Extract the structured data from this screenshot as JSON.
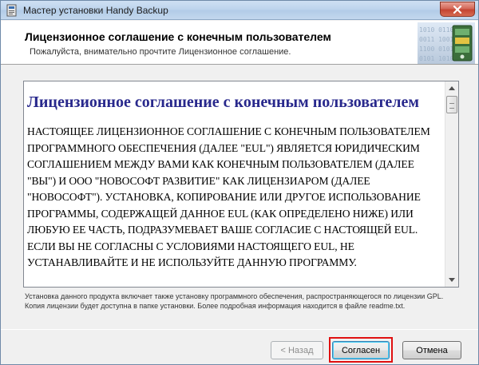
{
  "window": {
    "title": "Мастер установки Handy Backup"
  },
  "header": {
    "title": "Лицензионное соглашение с конечным пользователем",
    "subtitle": "Пожалуйста, внимательно прочтите Лицензионное соглашение."
  },
  "license": {
    "heading": "Лицензионное соглашение с конечным пользователем",
    "body": "НАСТОЯЩЕЕ ЛИЦЕНЗИОННОЕ СОГЛАШЕНИЕ С КОНЕЧНЫМ ПОЛЬЗОВАТЕЛЕМ ПРОГРАММНОГО ОБЕСПЕЧЕНИЯ (ДАЛЕЕ \"EUL\") ЯВЛЯЕТСЯ ЮРИДИЧЕСКИМ СОГЛАШЕНИЕМ МЕЖДУ ВАМИ КАК КОНЕЧНЫМ ПОЛЬЗОВАТЕЛЕМ (ДАЛЕЕ \"ВЫ\") И ООО \"НОВОСОФТ РАЗВИТИЕ\" КАК ЛИЦЕНЗИАРОМ (ДАЛЕЕ \"НОВОСОФТ\"). УСТАНОВКА, КОПИРОВАНИЕ ИЛИ ДРУГОЕ ИСПОЛЬЗОВАНИЕ ПРОГРАММЫ, СОДЕРЖАЩЕЙ ДАННОЕ EUL (КАК ОПРЕДЕЛЕНО НИЖЕ) ИЛИ ЛЮБУЮ ЕЕ ЧАСТЬ, ПОДРАЗУМЕВАЕТ ВАШЕ СОГЛАСИЕ С НАСТОЯЩЕЙ EUL. ЕСЛИ ВЫ НЕ СОГЛАСНЫ С УСЛОВИЯМИ НАСТОЯЩЕГО EUL, НЕ УСТАНАВЛИВАЙТЕ И НЕ ИСПОЛЬЗУЙТЕ ДАННУЮ ПРОГРАММУ."
  },
  "note": "Установка данного продукта включает также установку программного обеспечения, распространяющегося по лицензии GPL. Копия лицензии будет доступна в папке установки. Более подробная информация находится в файле readme.txt.",
  "buttons": {
    "back": "< Назад",
    "agree": "Согласен",
    "cancel": "Отмена"
  },
  "icons": {
    "app": "installer-app-icon",
    "close": "close-icon",
    "logo": "handy-backup-logo-icon",
    "scroll_up": "scroll-up-arrow-icon",
    "scroll_down": "scroll-down-arrow-icon"
  },
  "colors": {
    "heading": "#28288c",
    "highlight": "#e01010",
    "close_button": "#c44431"
  }
}
